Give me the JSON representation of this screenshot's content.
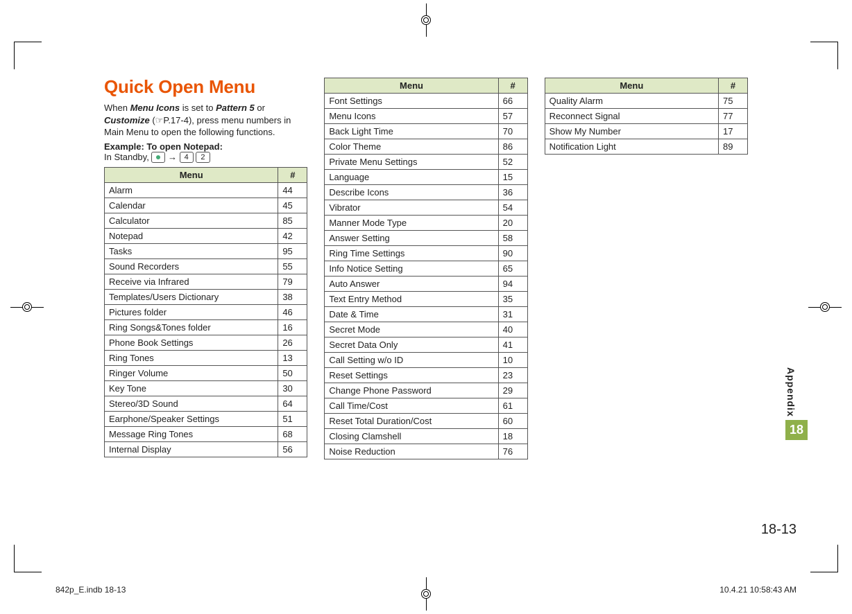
{
  "title": "Quick Open Menu",
  "intro": {
    "pref": "When ",
    "mi": "Menu Icons",
    "mid": " is set to ",
    "p5": "Pattern 5",
    "or": " or ",
    "cust": "Customize",
    "ref": " (☞P.17-4), press menu numbers in Main Menu to open the following functions."
  },
  "example_label": "Example: To open Notepad:",
  "standby": {
    "pre": "In Standby, ",
    "arrow": " → "
  },
  "keys": {
    "k1": "4",
    "k2": "2"
  },
  "thead": {
    "menu": "Menu",
    "hash": "#"
  },
  "table1": [
    {
      "m": "Alarm",
      "n": "44"
    },
    {
      "m": "Calendar",
      "n": "45"
    },
    {
      "m": "Calculator",
      "n": "85"
    },
    {
      "m": "Notepad",
      "n": "42"
    },
    {
      "m": "Tasks",
      "n": "95"
    },
    {
      "m": "Sound Recorders",
      "n": "55"
    },
    {
      "m": "Receive via Infrared",
      "n": "79"
    },
    {
      "m": "Templates/Users Dictionary",
      "n": "38"
    },
    {
      "m": "Pictures folder",
      "n": "46"
    },
    {
      "m": "Ring Songs&Tones folder",
      "n": "16"
    },
    {
      "m": "Phone Book Settings",
      "n": "26"
    },
    {
      "m": "Ring Tones",
      "n": "13"
    },
    {
      "m": "Ringer Volume",
      "n": "50"
    },
    {
      "m": "Key Tone",
      "n": "30"
    },
    {
      "m": "Stereo/3D Sound",
      "n": "64"
    },
    {
      "m": "Earphone/Speaker Settings",
      "n": "51"
    },
    {
      "m": "Message Ring Tones",
      "n": "68"
    },
    {
      "m": "Internal Display",
      "n": "56"
    }
  ],
  "table2": [
    {
      "m": "Font Settings",
      "n": "66"
    },
    {
      "m": "Menu Icons",
      "n": "57"
    },
    {
      "m": "Back Light Time",
      "n": "70"
    },
    {
      "m": "Color Theme",
      "n": "86"
    },
    {
      "m": "Private Menu Settings",
      "n": "52"
    },
    {
      "m": "Language",
      "n": "15"
    },
    {
      "m": "Describe Icons",
      "n": "36"
    },
    {
      "m": "Vibrator",
      "n": "54"
    },
    {
      "m": "Manner Mode Type",
      "n": "20"
    },
    {
      "m": "Answer Setting",
      "n": "58"
    },
    {
      "m": "Ring Time Settings",
      "n": "90"
    },
    {
      "m": "Info Notice Setting",
      "n": "65"
    },
    {
      "m": "Auto Answer",
      "n": "94"
    },
    {
      "m": "Text Entry Method",
      "n": "35"
    },
    {
      "m": "Date & Time",
      "n": "31"
    },
    {
      "m": "Secret Mode",
      "n": "40"
    },
    {
      "m": "Secret Data Only",
      "n": "41"
    },
    {
      "m": "Call Setting w/o ID",
      "n": "10"
    },
    {
      "m": "Reset Settings",
      "n": "23"
    },
    {
      "m": "Change Phone Password",
      "n": "29"
    },
    {
      "m": "Call Time/Cost",
      "n": "61"
    },
    {
      "m": "Reset Total Duration/Cost",
      "n": "60"
    },
    {
      "m": "Closing Clamshell",
      "n": "18"
    },
    {
      "m": "Noise Reduction",
      "n": "76"
    }
  ],
  "table3": [
    {
      "m": "Quality Alarm",
      "n": "75"
    },
    {
      "m": "Reconnect Signal",
      "n": "77"
    },
    {
      "m": "Show My Number",
      "n": "17"
    },
    {
      "m": "Notification Light",
      "n": "89"
    }
  ],
  "side": {
    "label": "Appendix",
    "chap": "18"
  },
  "pagenum": "18-13",
  "footer": {
    "left": "842p_E.indb   18-13",
    "right": "10.4.21   10:58:43 AM"
  }
}
